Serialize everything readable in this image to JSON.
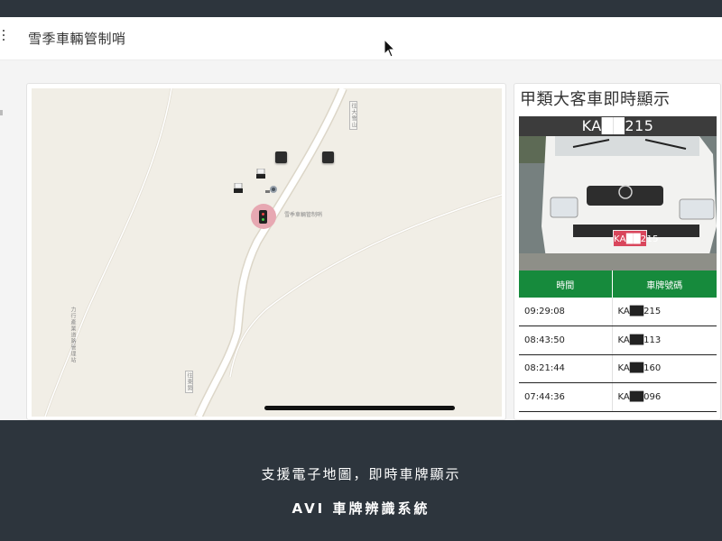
{
  "app": {
    "title": "雪季車輛管制哨"
  },
  "map": {
    "labels": {
      "road_top_right": "往大雪山",
      "station": "雪季車輛管制哨",
      "station_left": "力行產業道路管理站",
      "road_bottom": "往東勢"
    }
  },
  "panel": {
    "title": "甲類大客車即時顯示",
    "photo_plate": "KA██215",
    "small_plate": "KA██215",
    "table": {
      "headers": [
        "時間",
        "車牌號碼"
      ],
      "rows": [
        {
          "time": "09:29:08",
          "plate": "KA██215"
        },
        {
          "time": "08:43:50",
          "plate": "KA██113"
        },
        {
          "time": "08:21:44",
          "plate": "KA██160"
        },
        {
          "time": "07:44:36",
          "plate": "KA██096"
        }
      ]
    }
  },
  "caption": {
    "line1": "支援電子地圖，即時車牌顯示",
    "line2": "AVI 車牌辨識系統"
  },
  "colors": {
    "background": "#2d353d",
    "table_header": "#168a3c",
    "plate_red": "#d9465c",
    "map_bg": "#f1eee6"
  }
}
